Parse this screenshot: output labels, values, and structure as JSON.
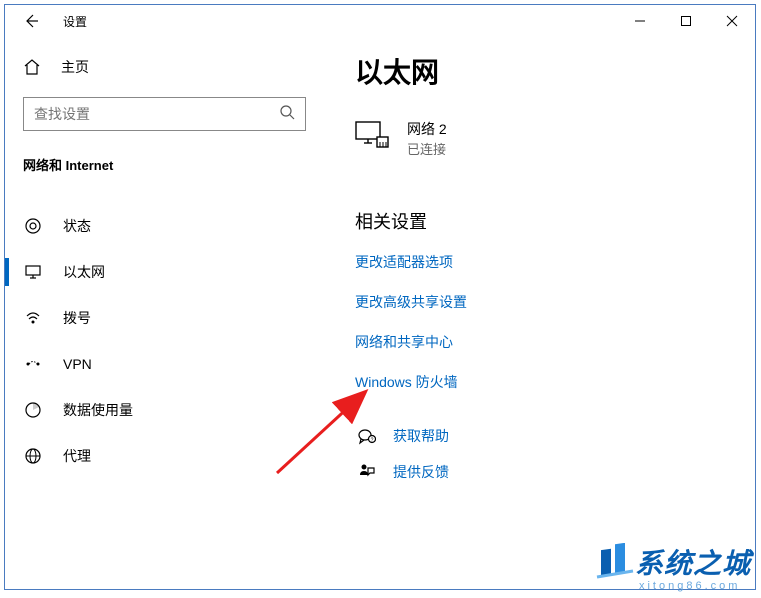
{
  "window": {
    "title": "设置"
  },
  "sidebar": {
    "home": "主页",
    "search_placeholder": "查找设置",
    "group": "网络和 Internet",
    "items": [
      {
        "label": "状态"
      },
      {
        "label": "以太网"
      },
      {
        "label": "拨号"
      },
      {
        "label": "VPN"
      },
      {
        "label": "数据使用量"
      },
      {
        "label": "代理"
      }
    ]
  },
  "main": {
    "title": "以太网",
    "network": {
      "name": "网络 2",
      "status": "已连接"
    },
    "related_title": "相关设置",
    "links": [
      "更改适配器选项",
      "更改高级共享设置",
      "网络和共享中心",
      "Windows 防火墙"
    ],
    "help": "获取帮助",
    "feedback": "提供反馈"
  },
  "watermark": {
    "main": "系统之城",
    "sub": "xitong86.com"
  }
}
